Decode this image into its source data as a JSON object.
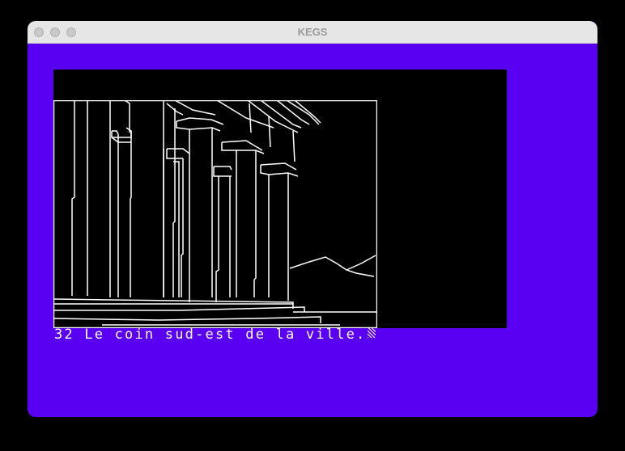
{
  "window": {
    "title": "KEGS"
  },
  "screen": {
    "caption": "32 Le coin sud-est de la ville.",
    "scene_icon": "temple-columns-illustration"
  },
  "colors": {
    "desktop": "#000000",
    "border": "#5a00f2",
    "screen": "#000000",
    "foreground": "#ffffff"
  }
}
